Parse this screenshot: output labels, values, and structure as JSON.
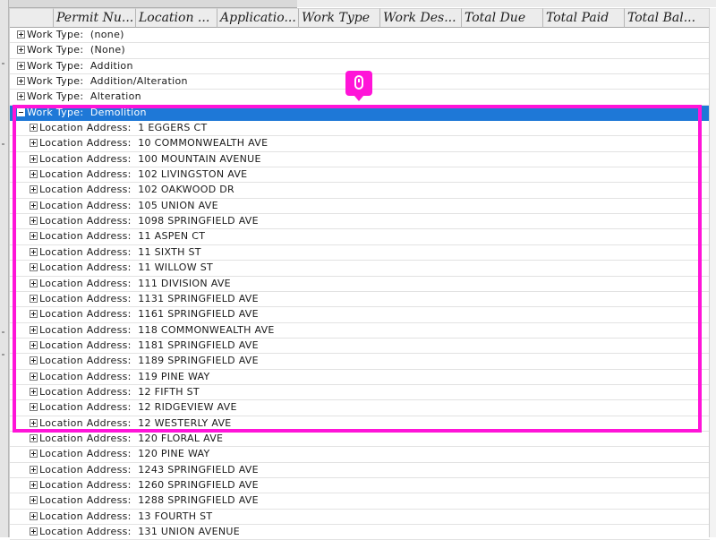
{
  "columns": [
    "",
    "Permit Nu...",
    "Location ...",
    "Applicatio...",
    "Work Type",
    "Work Des...",
    "Total Due",
    "Total Paid",
    "Total Bal..."
  ],
  "rows": [
    {
      "label": "Work Type:  (none)",
      "level": 0,
      "expanded": false
    },
    {
      "label": "Work Type:  (None)",
      "level": 0,
      "expanded": false
    },
    {
      "label": "Work Type:  Addition",
      "level": 0,
      "expanded": false
    },
    {
      "label": "Work Type:  Addition/Alteration",
      "level": 0,
      "expanded": false
    },
    {
      "label": "Work Type:  Alteration",
      "level": 0,
      "expanded": false
    },
    {
      "label": "Work Type:  Demolition",
      "level": 0,
      "expanded": true,
      "selected": true
    },
    {
      "label": "Location Address:  1 EGGERS CT",
      "level": 1,
      "expanded": false
    },
    {
      "label": "Location Address:  10 COMMONWEALTH AVE",
      "level": 1,
      "expanded": false
    },
    {
      "label": "Location Address:  100 MOUNTAIN AVENUE",
      "level": 1,
      "expanded": false
    },
    {
      "label": "Location Address:  102 LIVINGSTON AVE",
      "level": 1,
      "expanded": false
    },
    {
      "label": "Location Address:  102 OAKWOOD DR",
      "level": 1,
      "expanded": false
    },
    {
      "label": "Location Address:  105 UNION AVE",
      "level": 1,
      "expanded": false
    },
    {
      "label": "Location Address:  1098 SPRINGFIELD AVE",
      "level": 1,
      "expanded": false
    },
    {
      "label": "Location Address:  11 ASPEN CT",
      "level": 1,
      "expanded": false
    },
    {
      "label": "Location Address:  11 SIXTH ST",
      "level": 1,
      "expanded": false
    },
    {
      "label": "Location Address:  11 WILLOW ST",
      "level": 1,
      "expanded": false
    },
    {
      "label": "Location Address:  111 DIVISION AVE",
      "level": 1,
      "expanded": false
    },
    {
      "label": "Location Address:  1131 SPRINGFIELD AVE",
      "level": 1,
      "expanded": false
    },
    {
      "label": "Location Address:  1161 SPRINGFIELD AVE",
      "level": 1,
      "expanded": false
    },
    {
      "label": "Location Address:  118 COMMONWEALTH AVE",
      "level": 1,
      "expanded": false
    },
    {
      "label": "Location Address:  1181 SPRINGFIELD AVE",
      "level": 1,
      "expanded": false
    },
    {
      "label": "Location Address:  1189 SPRINGFIELD AVE",
      "level": 1,
      "expanded": false
    },
    {
      "label": "Location Address:  119 PINE WAY",
      "level": 1,
      "expanded": false
    },
    {
      "label": "Location Address:  12 FIFTH ST",
      "level": 1,
      "expanded": false
    },
    {
      "label": "Location Address:  12 RIDGEVIEW AVE",
      "level": 1,
      "expanded": false
    },
    {
      "label": "Location Address:  12 WESTERLY AVE",
      "level": 1,
      "expanded": false
    },
    {
      "label": "Location Address:  120 FLORAL AVE",
      "level": 1,
      "expanded": false
    },
    {
      "label": "Location Address:  120 PINE WAY",
      "level": 1,
      "expanded": false
    },
    {
      "label": "Location Address:  1243 SPRINGFIELD AVE",
      "level": 1,
      "expanded": false
    },
    {
      "label": "Location Address:  1260 SPRINGFIELD AVE",
      "level": 1,
      "expanded": false
    },
    {
      "label": "Location Address:  1288 SPRINGFIELD AVE",
      "level": 1,
      "expanded": false
    },
    {
      "label": "Location Address:  13 FOURTH ST",
      "level": 1,
      "expanded": false
    },
    {
      "label": "Location Address:  131 UNION AVENUE",
      "level": 1,
      "expanded": false
    }
  ],
  "highlight": {
    "icon": "mouse-icon",
    "color": "#ff14d8"
  },
  "colors": {
    "selection": "#1e78d7",
    "header_bg": "#ececec"
  }
}
